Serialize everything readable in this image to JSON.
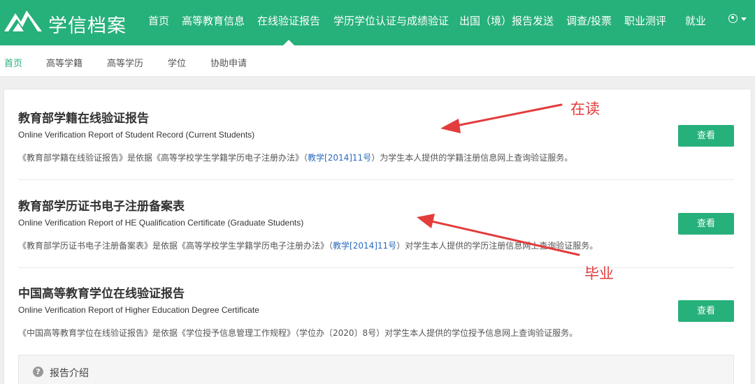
{
  "header": {
    "logo_text": "学信档案",
    "nav": [
      "首页",
      "高等教育信息",
      "在线验证报告",
      "学历学位认证与成绩验证",
      "出国（境）报告发送",
      "调查/投票",
      "职业测评",
      "就业"
    ],
    "active_nav_index": 2
  },
  "subnav": {
    "items": [
      "首页",
      "高等学籍",
      "高等学历",
      "学位",
      "协助申请"
    ],
    "active_index": 0
  },
  "reports": [
    {
      "title": "教育部学籍在线验证报告",
      "subtitle_en": "Online Verification Report of Student Record (Current Students)",
      "desc_pre": "《教育部学籍在线验证报告》是依据《高等学校学生学籍学历电子注册办法》（",
      "desc_link": "教学[2014]11号",
      "desc_post": "）为学生本人提供的学籍注册信息网上查询验证服务。",
      "button": "查看"
    },
    {
      "title": "教育部学历证书电子注册备案表",
      "subtitle_en": "Online Verification Report of HE Qualification Certificate (Graduate Students)",
      "desc_pre": "《教育部学历证书电子注册备案表》是依据《高等学校学生学籍学历电子注册办法》（",
      "desc_link": "教学[2014]11号",
      "desc_post": "）对学生本人提供的学历注册信息网上查询验证服务。",
      "button": "查看"
    },
    {
      "title": "中国高等教育学位在线验证报告",
      "subtitle_en": "Online Verification Report of Higher Education Degree Certificate",
      "desc_pre": "《中国高等教育学位在线验证报告》是依据《学位授予信息管理工作规程》（学位办〔2020〕8号）对学生本人提供的学位授予信息网上查询验证服务。",
      "desc_link": "",
      "desc_post": "",
      "button": "查看"
    }
  ],
  "intro": {
    "label": "报告介绍",
    "icon": "question-icon"
  },
  "annotations": {
    "current": "在读",
    "graduate": "毕业",
    "color": "#e23c3c"
  },
  "colors": {
    "brand": "#26b07a",
    "link": "#2a6bbf"
  }
}
